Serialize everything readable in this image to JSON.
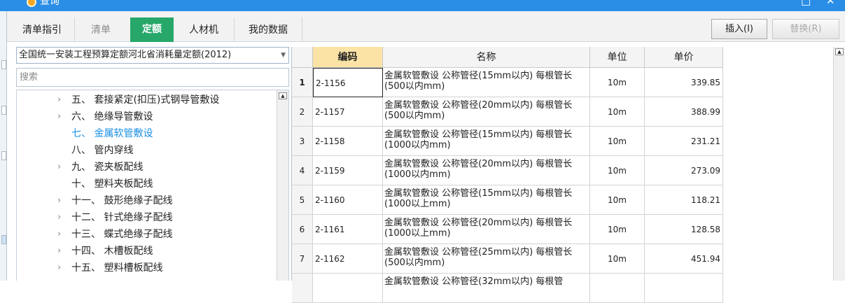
{
  "window": {
    "title": "查询",
    "restore_glyph": "□",
    "close_glyph": "✕"
  },
  "tabs": [
    {
      "label": "清单指引"
    },
    {
      "label": "清单"
    },
    {
      "label": "定额"
    },
    {
      "label": "人材机"
    },
    {
      "label": "我的数据"
    }
  ],
  "actions": {
    "insert_label": "插入(I)",
    "replace_label": "替换(R)"
  },
  "left": {
    "library_selected": "全国统一安装工程预算定额河北省消耗量定额(2012)",
    "search_placeholder": "搜索",
    "tree": [
      {
        "chev": "›",
        "label": "五、 套接紧定(扣压)式钢导管敷设"
      },
      {
        "chev": "›",
        "label": "六、 绝缘导管敷设"
      },
      {
        "chev": "",
        "label": "七、 金属软管敷设",
        "selected": true
      },
      {
        "chev": "",
        "label": "八、 管内穿线"
      },
      {
        "chev": "›",
        "label": "九、 瓷夹板配线"
      },
      {
        "chev": "",
        "label": "十、 塑料夹板配线"
      },
      {
        "chev": "›",
        "label": "十一、 鼓形绝缘子配线"
      },
      {
        "chev": "›",
        "label": "十二、 针式绝缘子配线"
      },
      {
        "chev": "›",
        "label": "十三、 蝶式绝缘子配线"
      },
      {
        "chev": "›",
        "label": "十四、 木槽板配线"
      },
      {
        "chev": "›",
        "label": "十五、 塑料槽板配线"
      }
    ]
  },
  "grid": {
    "headers": {
      "code": "编码",
      "name": "名称",
      "unit": "单位",
      "price": "单价"
    },
    "rows": [
      {
        "no": "1",
        "code": "2-1156",
        "name": "金属软管敷设 公称管径(15mm以内) 每根管长(500以内mm)",
        "unit": "10m",
        "price": "339.85"
      },
      {
        "no": "2",
        "code": "2-1157",
        "name": "金属软管敷设 公称管径(20mm以内) 每根管长(500以内mm)",
        "unit": "10m",
        "price": "388.99"
      },
      {
        "no": "3",
        "code": "2-1158",
        "name": "金属软管敷设 公称管径(15mm以内) 每根管长(1000以内mm)",
        "unit": "10m",
        "price": "231.21"
      },
      {
        "no": "4",
        "code": "2-1159",
        "name": "金属软管敷设 公称管径(20mm以内) 每根管长(1000以内mm)",
        "unit": "10m",
        "price": "273.09"
      },
      {
        "no": "5",
        "code": "2-1160",
        "name": "金属软管敷设 公称管径(15mm以内) 每根管长(1000以上mm)",
        "unit": "10m",
        "price": "118.21"
      },
      {
        "no": "6",
        "code": "2-1161",
        "name": "金属软管敷设 公称管径(20mm以内) 每根管长(1000以上mm)",
        "unit": "10m",
        "price": "128.58"
      },
      {
        "no": "7",
        "code": "2-1162",
        "name": "金属软管敷设 公称管径(25mm以内) 每根管长(500以内mm)",
        "unit": "10m",
        "price": "451.94"
      },
      {
        "no": "",
        "code": "",
        "name": "金属软管敷设 公称管径(32mm以内) 每根管",
        "unit": "",
        "price": ""
      }
    ]
  },
  "colors": {
    "titlebar": "#2a8ee6",
    "active_tab": "#27a86a",
    "code_header": "#fbe3a6",
    "selected_tree": "#1a8fe3"
  }
}
